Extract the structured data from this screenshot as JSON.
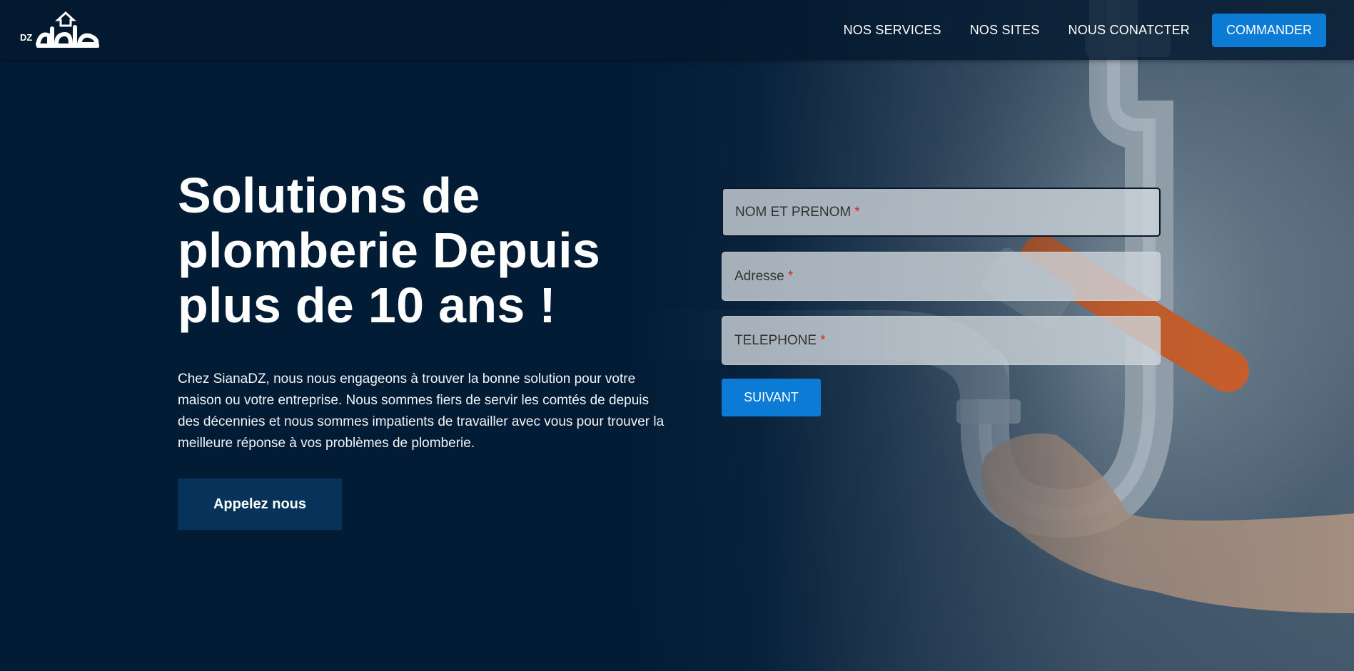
{
  "header": {
    "logo": {
      "dz_label": "DZ",
      "brand_arabic": "هيالة"
    },
    "nav": [
      {
        "label": "NOS SERVICES"
      },
      {
        "label": "NOS SITES"
      },
      {
        "label": "NOUS CONATCTER"
      }
    ],
    "cta_label": "COMMANDER"
  },
  "hero": {
    "title": "Solutions de plomberie Depuis plus de 10 ans !",
    "description": "Chez SianaDZ, nous nous engageons à trouver la bonne solution pour votre maison ou votre entreprise. Nous sommes fiers de servir les comtés de depuis des décennies et nous sommes impatients de travailler avec vous pour trouver la meilleure réponse à vos problèmes de plomberie.",
    "button_label": "Appelez nous"
  },
  "form": {
    "fields": [
      {
        "label": "NOM ET PRENOM",
        "required_mark": "*"
      },
      {
        "label": "Adresse",
        "required_mark": "*"
      },
      {
        "label": "TELEPHONE",
        "required_mark": "*"
      }
    ],
    "submit_label": "SUIVANT"
  },
  "colors": {
    "background": "#021c36",
    "accent": "#0b7bd6",
    "hero_button": "#073259",
    "required": "#e02020"
  }
}
